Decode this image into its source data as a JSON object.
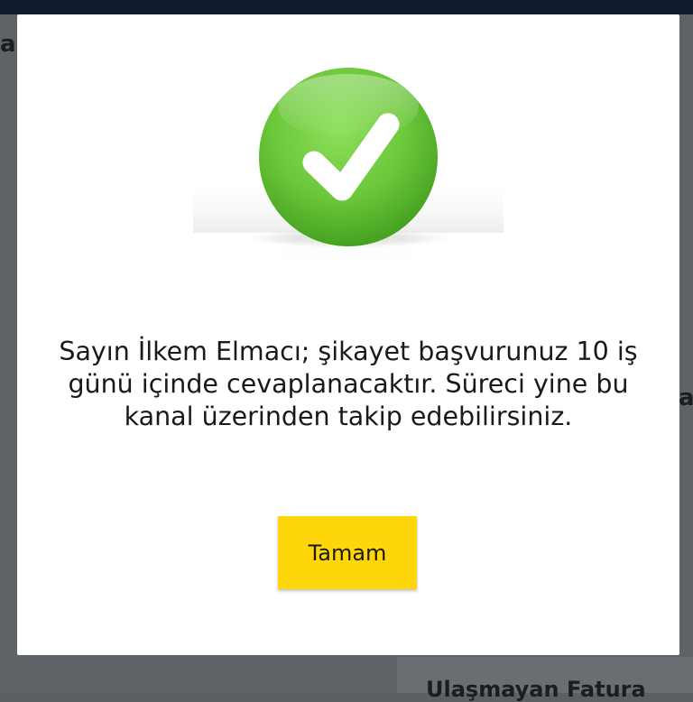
{
  "background": {
    "left_fragment": "a",
    "right_fragment": "a",
    "bottom_fragment": "Ulaşmayan Fatura"
  },
  "dialog": {
    "icon": "checkmark-success-icon",
    "message": "Sayın İlkem Elmacı; şikayet başvurunuz 10 iş günü içinde cevaplanacaktır. Süreci yine bu kanal üzerinden takip edebilirsiniz.",
    "ok_button_label": "Tamam"
  },
  "colors": {
    "success_green": "#6cc63a",
    "button_yellow": "#ffd60a",
    "overlay": "#5f6266",
    "top_bar": "#0f1b2d"
  }
}
